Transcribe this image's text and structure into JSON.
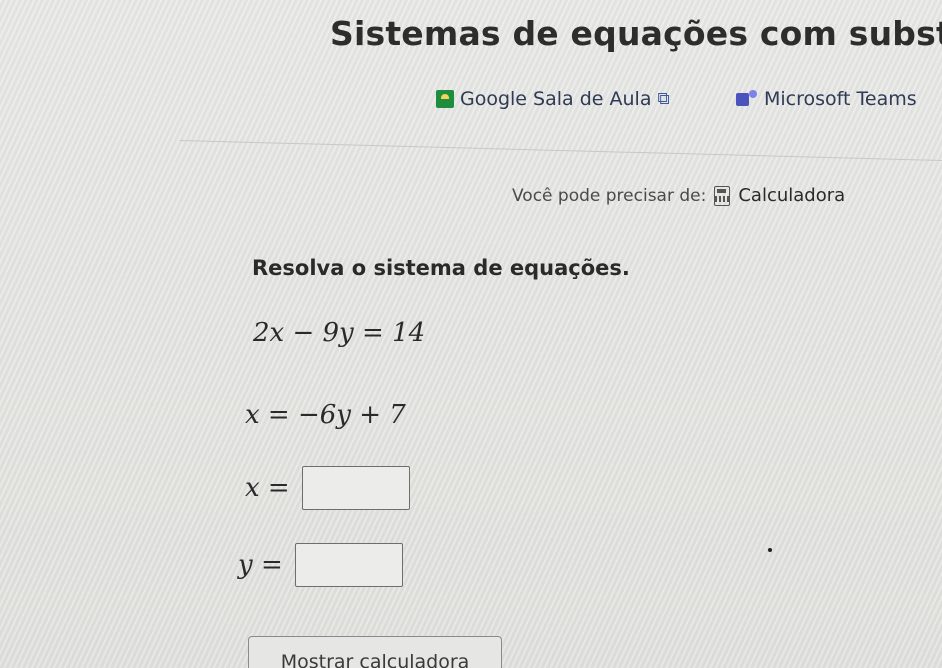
{
  "header": {
    "title": "Sistemas de equações com substitu"
  },
  "links": {
    "google_label": "Google Sala de Aula",
    "teams_label": "Microsoft Teams"
  },
  "tools": {
    "need_text": "Você pode precisar de:",
    "calculator_label": "Calculadora"
  },
  "problem": {
    "prompt": "Resolva o sistema de equações.",
    "equation_1": "2x − 9y = 14",
    "equation_2": "x = −6y + 7"
  },
  "answers": {
    "x_label": "x =",
    "x_value": "",
    "y_label": "y =",
    "y_value": ""
  },
  "footer": {
    "show_calculator_label": "Mostrar calculadora"
  },
  "colors": {
    "background": "#e8e8e6",
    "google_classroom": "#1e8e3e",
    "teams": "#4b53bc"
  },
  "icons": {
    "google": "google-classroom-icon",
    "teams": "microsoft-teams-icon",
    "external": "external-link-icon",
    "calculator": "calculator-icon"
  }
}
